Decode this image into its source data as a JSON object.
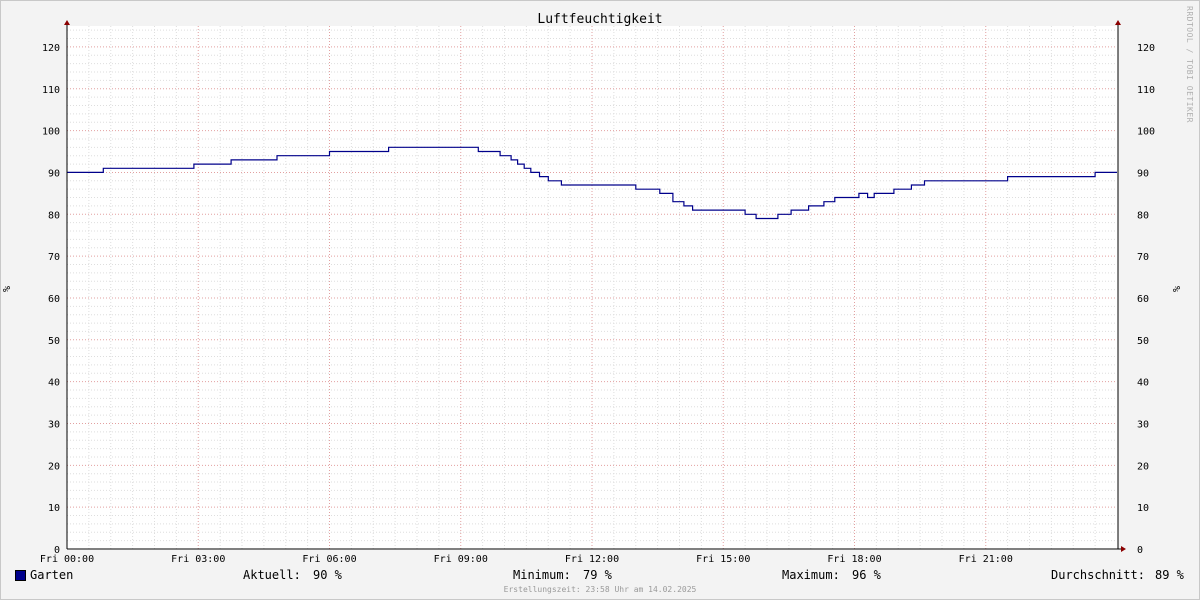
{
  "chart_data": {
    "type": "line",
    "title": "Luftfeuchtigkeit",
    "ylabel": "%",
    "ylim": [
      0,
      125
    ],
    "xlim": [
      0,
      24
    ],
    "y_ticks": [
      0,
      10,
      20,
      30,
      40,
      50,
      60,
      70,
      80,
      90,
      100,
      110,
      120
    ],
    "x_ticks": [
      {
        "value": 0,
        "label": "Fri 00:00"
      },
      {
        "value": 3,
        "label": "Fri 03:00"
      },
      {
        "value": 6,
        "label": "Fri 06:00"
      },
      {
        "value": 9,
        "label": "Fri 09:00"
      },
      {
        "value": 12,
        "label": "Fri 12:00"
      },
      {
        "value": 15,
        "label": "Fri 15:00"
      },
      {
        "value": 18,
        "label": "Fri 18:00"
      },
      {
        "value": 21,
        "label": "Fri 21:00"
      }
    ],
    "grid": true,
    "series": [
      {
        "name": "Garten",
        "color": "#00008b",
        "x": [
          0,
          0.83,
          2.9,
          3.75,
          4.8,
          6.0,
          7.35,
          9.4,
          9.9,
          10.15,
          10.3,
          10.45,
          10.6,
          10.8,
          11.0,
          11.3,
          11.6,
          13.0,
          13.55,
          13.85,
          14.1,
          14.3,
          15.0,
          15.5,
          15.75,
          16.25,
          16.55,
          16.95,
          17.3,
          17.55,
          18.1,
          18.3,
          18.45,
          18.9,
          19.3,
          19.6,
          21.5,
          23.5,
          24.0
        ],
        "y": [
          90,
          91,
          92,
          93,
          94,
          95,
          96,
          95,
          94,
          93,
          92,
          91,
          90,
          89,
          88,
          87,
          87,
          86,
          85,
          83,
          82,
          81,
          81,
          80,
          79,
          80,
          81,
          82,
          83,
          84,
          85,
          84,
          85,
          86,
          87,
          88,
          89,
          90,
          90
        ]
      }
    ]
  },
  "legend": {
    "series_name": "Garten",
    "current_label": "Aktuell:",
    "current_value": "90 %",
    "min_label": "Minimum:",
    "min_value": "79 %",
    "max_label": "Maximum:",
    "max_value": "96 %",
    "avg_label": "Durchschnitt:",
    "avg_value": "89 %"
  },
  "footer": "Erstellungszeit: 23:58 Uhr am 14.02.2025",
  "watermark": "RRDTOOL / TOBI OETIKER"
}
